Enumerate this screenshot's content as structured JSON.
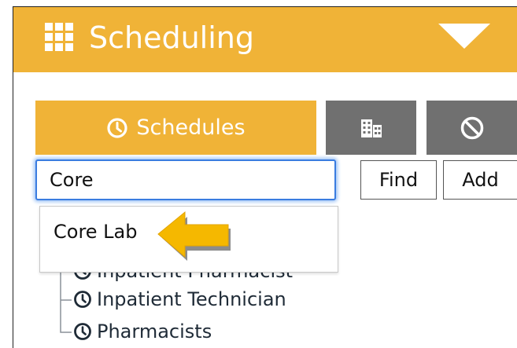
{
  "header": {
    "title": "Scheduling",
    "menu_icon": "grid-icon",
    "toggle_icon": "caret-down-icon",
    "background_color": "#f0b337"
  },
  "tabs": [
    {
      "label": "Schedules",
      "icon": "clock-icon",
      "active": true
    },
    {
      "label": "",
      "icon": "buildings-icon",
      "active": false
    },
    {
      "label": "",
      "icon": "ban-icon",
      "active": false
    }
  ],
  "search": {
    "value": "Core",
    "placeholder": ""
  },
  "buttons": {
    "find_label": "Find",
    "add_label": "Add"
  },
  "autocomplete": {
    "items": [
      "Core Lab"
    ],
    "pointer_icon": "arrow-left-icon",
    "pointer_color": "#f5b800"
  },
  "tree": {
    "items": [
      {
        "label": "Inpatient Pharmacist",
        "icon": "clock-icon"
      },
      {
        "label": "Inpatient Technician",
        "icon": "clock-icon"
      },
      {
        "label": "Pharmacists",
        "icon": "clock-icon"
      }
    ]
  },
  "colors": {
    "accent": "#f0b337",
    "inactive_tab": "#707070",
    "focus": "#3a7ce0",
    "text": "#1f2b37"
  }
}
